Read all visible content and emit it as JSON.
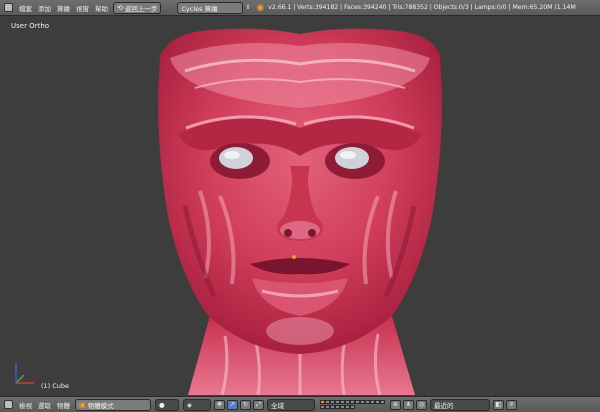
{
  "topbar": {
    "menus": [
      "檔案",
      "添加",
      "算繪",
      "視窗",
      "幫助"
    ],
    "undo_label": "返回上一步",
    "engine": "Cycles 算繪",
    "stats": "v2.66.1 | Verts:394182 | Faces:394240 | Tris:788352 | Objects:0/3 | Lamps:0/0 | Mem:65.20M (1.14M"
  },
  "viewport": {
    "view_name": "User Ortho",
    "active_object": "(1) Cube"
  },
  "bottombar": {
    "menus": [
      "檢視",
      "選取",
      "物體"
    ],
    "mode": "物體模式",
    "pivot": "全域",
    "snap": "最近的"
  },
  "colors": {
    "skin": "#d9405c",
    "skin_highlight": "#f6b3c2",
    "background": "#3d3d3d",
    "header": "#636363",
    "axis_x": "#d13b3b",
    "axis_y": "#3bb13b",
    "axis_z": "#3b5bd1"
  }
}
